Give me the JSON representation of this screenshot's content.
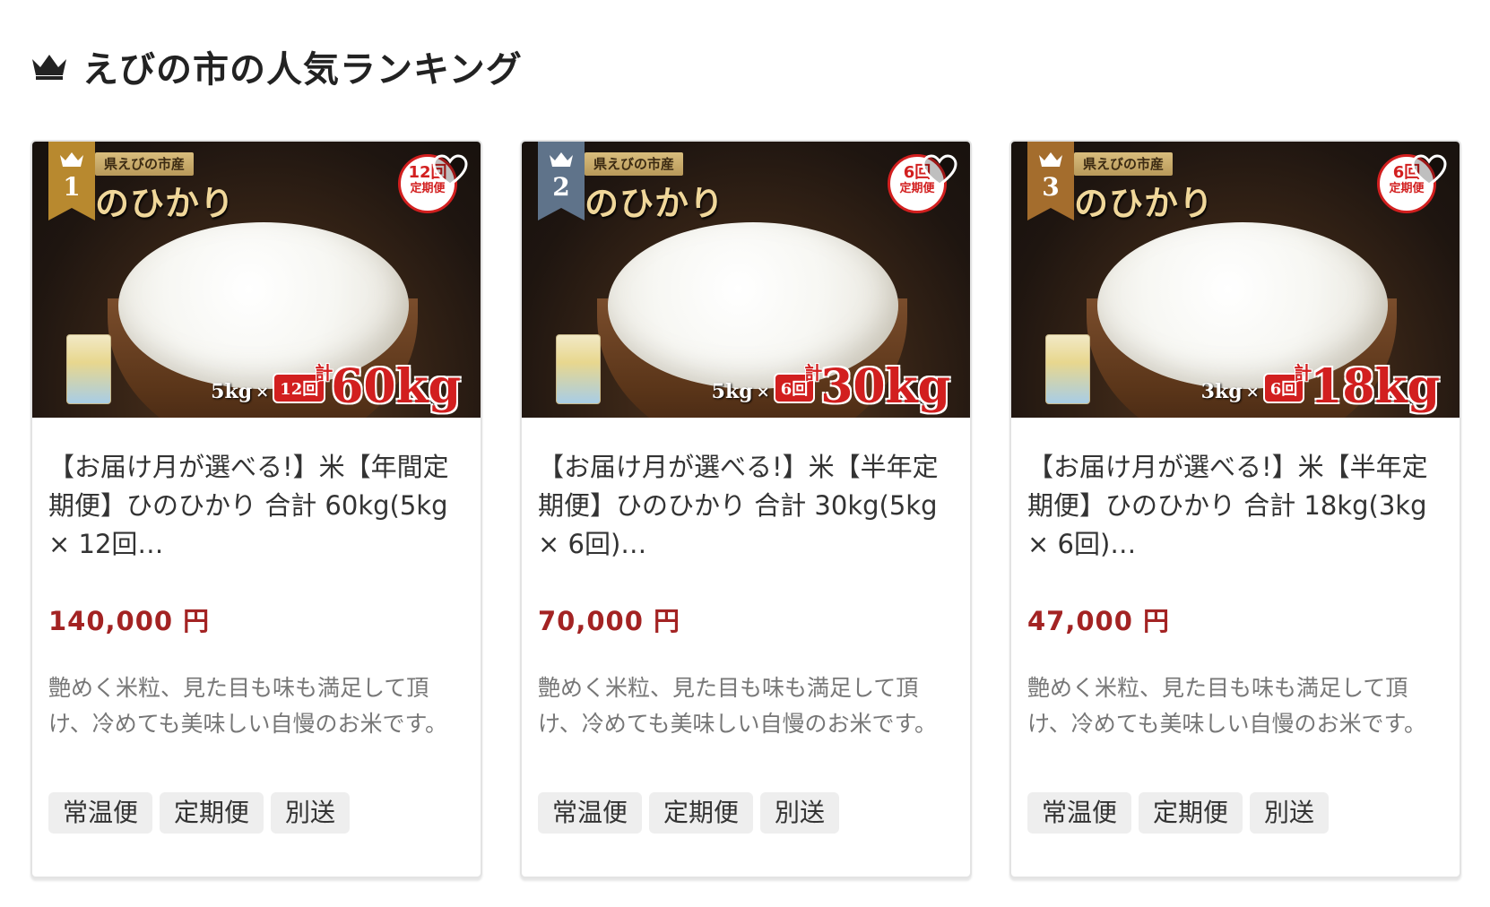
{
  "header": {
    "icon": "crown-icon",
    "title": "えびの市の人気ランキング"
  },
  "colors": {
    "price": "#a32323",
    "gold": "#b8892f",
    "silver": "#5f738a",
    "bronze": "#a46d2d",
    "badge_red": "#d21f1f"
  },
  "cards": [
    {
      "rank": "1",
      "rank_color": "#b8892f",
      "image": {
        "label": "県えびの市産",
        "name": "のひかり",
        "badge_count": "12回",
        "badge_kind": "定期便",
        "unit_amount": "5kg",
        "times_symbol": "×",
        "times": "12回",
        "total_prefix": "計",
        "total": "60kg"
      },
      "title": "【お届け月が選べる!】米【年間定期便】ひのひかり 合計 60kg(5kg × 12回…",
      "price": "140,000 円",
      "description": "艶めく米粒、見た目も味も満足して頂け、冷めても美味しい自慢のお米です。",
      "tags": [
        "常温便",
        "定期便",
        "別送"
      ]
    },
    {
      "rank": "2",
      "rank_color": "#5f738a",
      "image": {
        "label": "県えびの市産",
        "name": "のひかり",
        "badge_count": "6回",
        "badge_kind": "定期便",
        "unit_amount": "5kg",
        "times_symbol": "×",
        "times": "6回",
        "total_prefix": "計",
        "total": "30kg"
      },
      "title": "【お届け月が選べる!】米【半年定期便】ひのひかり 合計 30kg(5kg × 6回)…",
      "price": "70,000 円",
      "description": "艶めく米粒、見た目も味も満足して頂け、冷めても美味しい自慢のお米です。",
      "tags": [
        "常温便",
        "定期便",
        "別送"
      ]
    },
    {
      "rank": "3",
      "rank_color": "#a46d2d",
      "image": {
        "label": "県えびの市産",
        "name": "のひかり",
        "badge_count": "6回",
        "badge_kind": "定期便",
        "unit_amount": "3kg",
        "times_symbol": "×",
        "times": "6回",
        "total_prefix": "計",
        "total": "18kg"
      },
      "title": "【お届け月が選べる!】米【半年定期便】ひのひかり 合計 18kg(3kg × 6回)…",
      "price": "47,000 円",
      "description": "艶めく米粒、見た目も味も満足して頂け、冷めても美味しい自慢のお米です。",
      "tags": [
        "常温便",
        "定期便",
        "別送"
      ]
    }
  ]
}
